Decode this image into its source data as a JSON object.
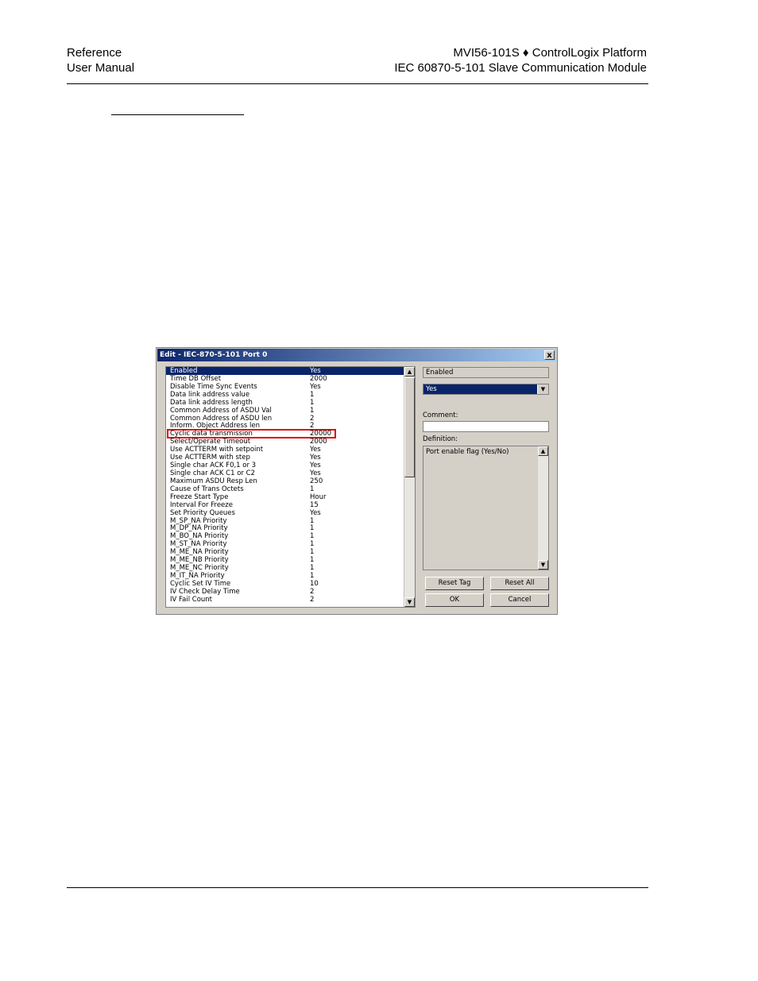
{
  "header": {
    "left_line1": "Reference",
    "left_line2": "User Manual",
    "right_line1": "MVI56-101S ♦ ControlLogix Platform",
    "right_line2": "IEC 60870-5-101 Slave Communication Module"
  },
  "dialog": {
    "title": "Edit - IEC-870-5-101 Port 0",
    "close_glyph": "x",
    "list": [
      {
        "name": "Enabled",
        "value": "Yes"
      },
      {
        "name": "Time DB Offset",
        "value": "2000"
      },
      {
        "name": "Disable Time Sync Events",
        "value": "Yes"
      },
      {
        "name": "Data link address value",
        "value": "1"
      },
      {
        "name": "Data link address length",
        "value": "1"
      },
      {
        "name": "Common Address of ASDU Val",
        "value": "1"
      },
      {
        "name": "Common Address of ASDU len",
        "value": "2"
      },
      {
        "name": "Inform. Object Address len",
        "value": "2"
      },
      {
        "name": "Cyclic data transmission",
        "value": "20000"
      },
      {
        "name": "Select/Operate Timeout",
        "value": "2000"
      },
      {
        "name": "Use ACTTERM with setpoint",
        "value": "Yes"
      },
      {
        "name": "Use ACTTERM with step",
        "value": "Yes"
      },
      {
        "name": "Single char ACK F0,1 or 3",
        "value": "Yes"
      },
      {
        "name": "Single char ACK C1 or C2",
        "value": "Yes"
      },
      {
        "name": "Maximum ASDU Resp Len",
        "value": "250"
      },
      {
        "name": "Cause of Trans Octets",
        "value": "1"
      },
      {
        "name": "Freeze Start Type",
        "value": "Hour"
      },
      {
        "name": "Interval For Freeze",
        "value": "15"
      },
      {
        "name": "Set Priority Queues",
        "value": "Yes"
      },
      {
        "name": "M_SP_NA Priority",
        "value": "1"
      },
      {
        "name": "M_DP_NA Priority",
        "value": "1"
      },
      {
        "name": "M_BO_NA Priority",
        "value": "1"
      },
      {
        "name": "M_ST_NA Priority",
        "value": "1"
      },
      {
        "name": "M_ME_NA Priority",
        "value": "1"
      },
      {
        "name": "M_ME_NB Priority",
        "value": "1"
      },
      {
        "name": "M_ME_NC Priority",
        "value": "1"
      },
      {
        "name": "M_IT_NA Priority",
        "value": "1"
      },
      {
        "name": "Cyclic Set IV Time",
        "value": "10"
      },
      {
        "name": "IV Check Delay Time",
        "value": "2"
      },
      {
        "name": "IV Fail Count",
        "value": "2"
      }
    ],
    "selected_param": "Enabled",
    "value_select": "Yes",
    "comment_label": "Comment:",
    "comment_value": "",
    "definition_label": "Definition:",
    "definition_text": "Port enable flag (Yes/No)",
    "buttons": {
      "reset_tag": "Reset Tag",
      "reset_all": "Reset All",
      "ok": "OK",
      "cancel": "Cancel"
    }
  },
  "colors": {
    "selection": "#0a246a",
    "highlight_box": "#e00000",
    "dialog_face": "#d4d0c8"
  }
}
